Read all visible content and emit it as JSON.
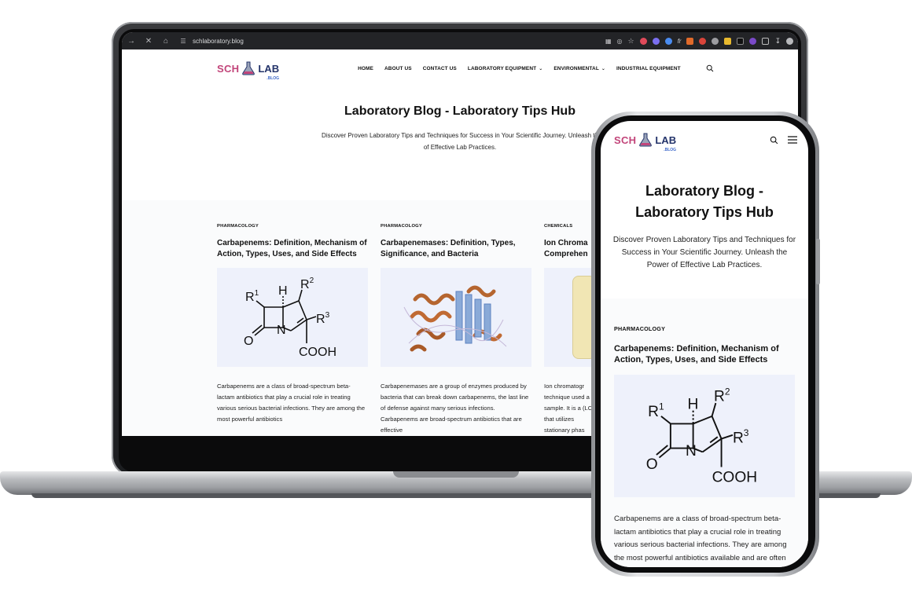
{
  "browser": {
    "url": "schlaboratory.blog"
  },
  "logo": {
    "sch": "SCH",
    "lab": "LAB",
    "blog": ".BLOG"
  },
  "nav": {
    "items": [
      "HOME",
      "ABOUT US",
      "CONTACT US",
      "LABORATORY EQUIPMENT",
      "ENVIRONMENTAL",
      "INDUSTRIAL EQUIPMENT"
    ]
  },
  "hero": {
    "title": "Laboratory Blog - Laboratory Tips Hub",
    "subtitle_desktop_line1": "Discover Proven Laboratory Tips and Techniques for Success in Your Scientific Journey. Unleash th",
    "subtitle_desktop_line2": "of Effective Lab Practices.",
    "subtitle_mobile": "Discover Proven Laboratory Tips and Techniques for Success in Your Scientific Journey. Unleash the Power of Effective Lab Practices."
  },
  "mobile_title_line1": "Laboratory Blog -",
  "mobile_title_line2": "Laboratory Tips Hub",
  "posts": [
    {
      "category": "PHARMACOLOGY",
      "title": "Carbapenems: Definition, Mechanism of Action, Types, Uses, and Side Effects",
      "excerpt": "Carbapenems are a class of broad-spectrum beta-lactam antibiotics that play a crucial role in treating various serious bacterial infections. They are among the most powerful antibiotics"
    },
    {
      "category": "PHARMACOLOGY",
      "title": "Carbapenemases: Definition, Types, Significance, and Bacteria",
      "excerpt": "Carbapenemases are a group of enzymes produced by bacteria that can break down carbapenems, the last line of defense against many serious infections. Carbapenems are broad-spectrum antibiotics that are effective"
    },
    {
      "category": "CHEMICALS",
      "title": "Ion Chroma Comprehen",
      "excerpt": "Ion chromatogr technique used a sample. It is a (LC) that utilizes stationary phas"
    }
  ],
  "mobile_post": {
    "category": "PHARMACOLOGY",
    "title": "Carbapenems: Definition, Mechanism of Action, Types, Uses, and Side Effects",
    "excerpt": "Carbapenems are a class of broad-spectrum beta-lactam antibiotics that play a crucial role in treating various serious bacterial infections. They are among the most powerful antibiotics available and are often reserved as a last resort for treating infections"
  },
  "molecule": {
    "r1": "R",
    "r1_sup": "1",
    "r2": "R",
    "r2_sup": "2",
    "r3": "R",
    "r3_sup": "3",
    "h": "H",
    "n": "N",
    "o": "O",
    "cooh": "COOH"
  },
  "colors": {
    "brand_pink": "#c2457a",
    "brand_navy": "#23336a",
    "thumb_bg": "#eef1fb"
  }
}
